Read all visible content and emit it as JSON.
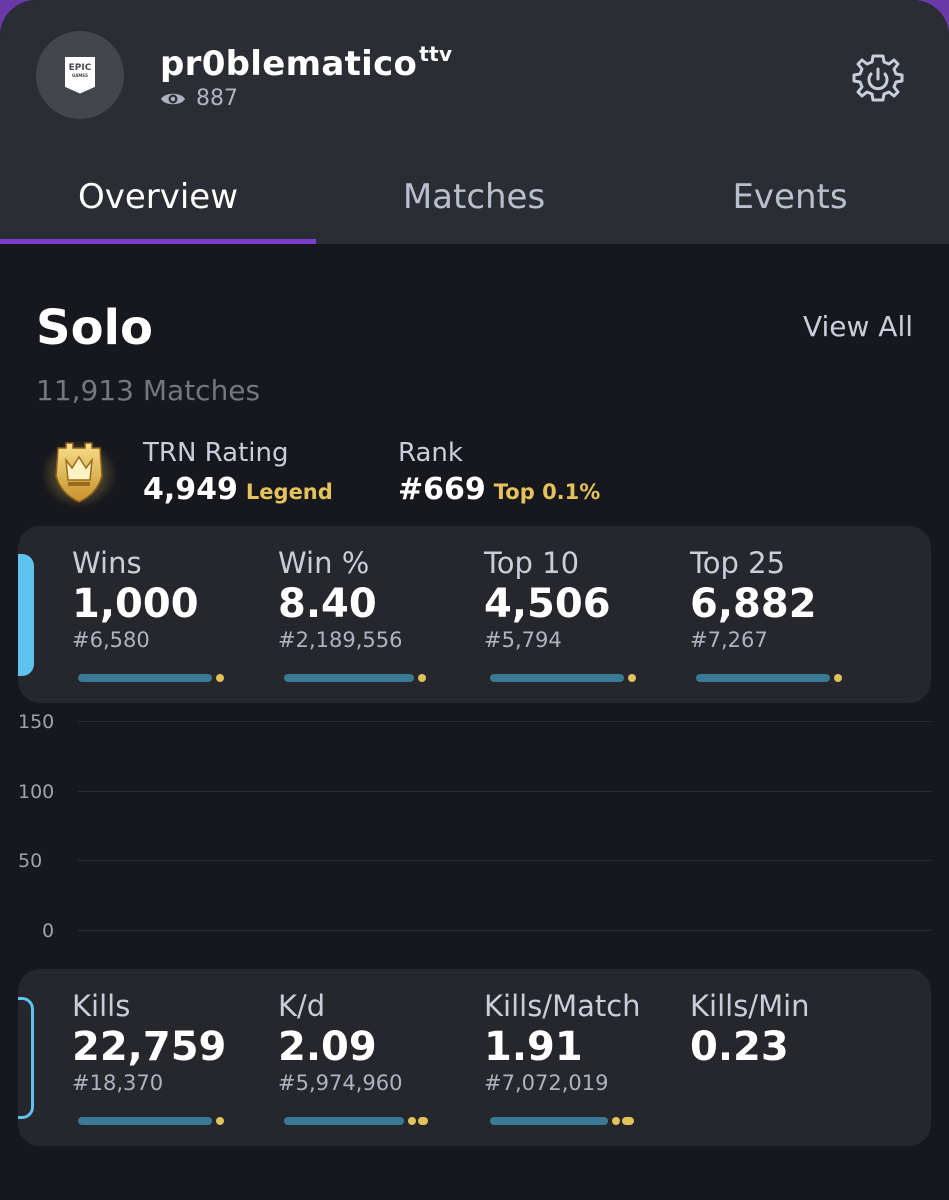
{
  "profile": {
    "logo_text": "EPIC",
    "logo_subtext": "GAMES",
    "username": "pr0blematico",
    "username_suffix": "ttv",
    "views": "887"
  },
  "tabs": [
    {
      "label": "Overview",
      "active": true
    },
    {
      "label": "Matches",
      "active": false
    },
    {
      "label": "Events",
      "active": false
    }
  ],
  "section": {
    "title": "Solo",
    "view_all": "View All",
    "matches": "11,913 Matches"
  },
  "rating": {
    "trn_label": "TRN Rating",
    "trn_value": "4,949",
    "trn_tier": "Legend",
    "rank_label": "Rank",
    "rank_value": "#669",
    "rank_top": "Top 0.1%"
  },
  "stats_primary": [
    {
      "label": "Wins",
      "value": "1,000",
      "rank": "#6,580"
    },
    {
      "label": "Win %",
      "value": "8.40",
      "rank": "#2,189,556"
    },
    {
      "label": "Top 10",
      "value": "4,506",
      "rank": "#5,794"
    },
    {
      "label": "Top 25",
      "value": "6,882",
      "rank": "#7,267"
    }
  ],
  "stats_secondary": [
    {
      "label": "Kills",
      "value": "22,759",
      "rank": "#18,370"
    },
    {
      "label": "K/d",
      "value": "2.09",
      "rank": "#5,974,960"
    },
    {
      "label": "Kills/Match",
      "value": "1.91",
      "rank": "#7,072,019"
    },
    {
      "label": "Kills/Min",
      "value": "0.23",
      "rank": ""
    }
  ],
  "chart_data": {
    "type": "line",
    "yticks": [
      "150",
      "100",
      "50",
      "0"
    ],
    "ylim": [
      0,
      150
    ],
    "grid": true,
    "series": []
  },
  "colors": {
    "accent_purple": "#7b3fd0",
    "highlight_gold": "#e6c25c",
    "bar_blue": "#3b7a96",
    "accent_cyan": "#5ec3f0"
  }
}
